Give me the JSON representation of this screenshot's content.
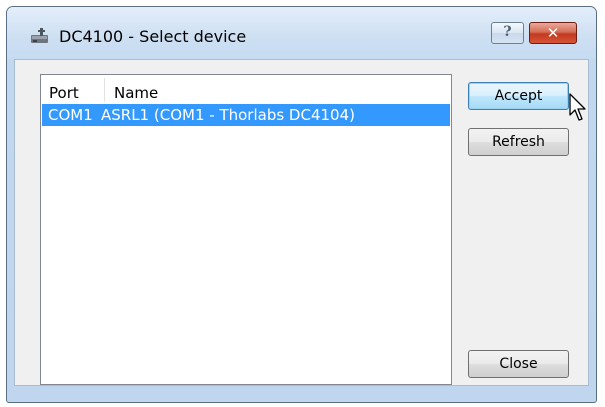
{
  "window": {
    "title": "DC4100 - Select device",
    "help_glyph": "?",
    "close_glyph": "✕",
    "title_icon": "device-icon"
  },
  "device_list": {
    "columns": [
      "Port",
      "Name"
    ],
    "rows": [
      {
        "port": "COM1",
        "name": "ASRL1  (COM1 - Thorlabs DC4104)",
        "selected": true
      }
    ]
  },
  "buttons": {
    "accept": "Accept",
    "refresh": "Refresh",
    "close": "Close"
  },
  "colors": {
    "selection": "#3399ff",
    "window_frame": "#bfd6ee",
    "close_button": "#c23a1f"
  }
}
